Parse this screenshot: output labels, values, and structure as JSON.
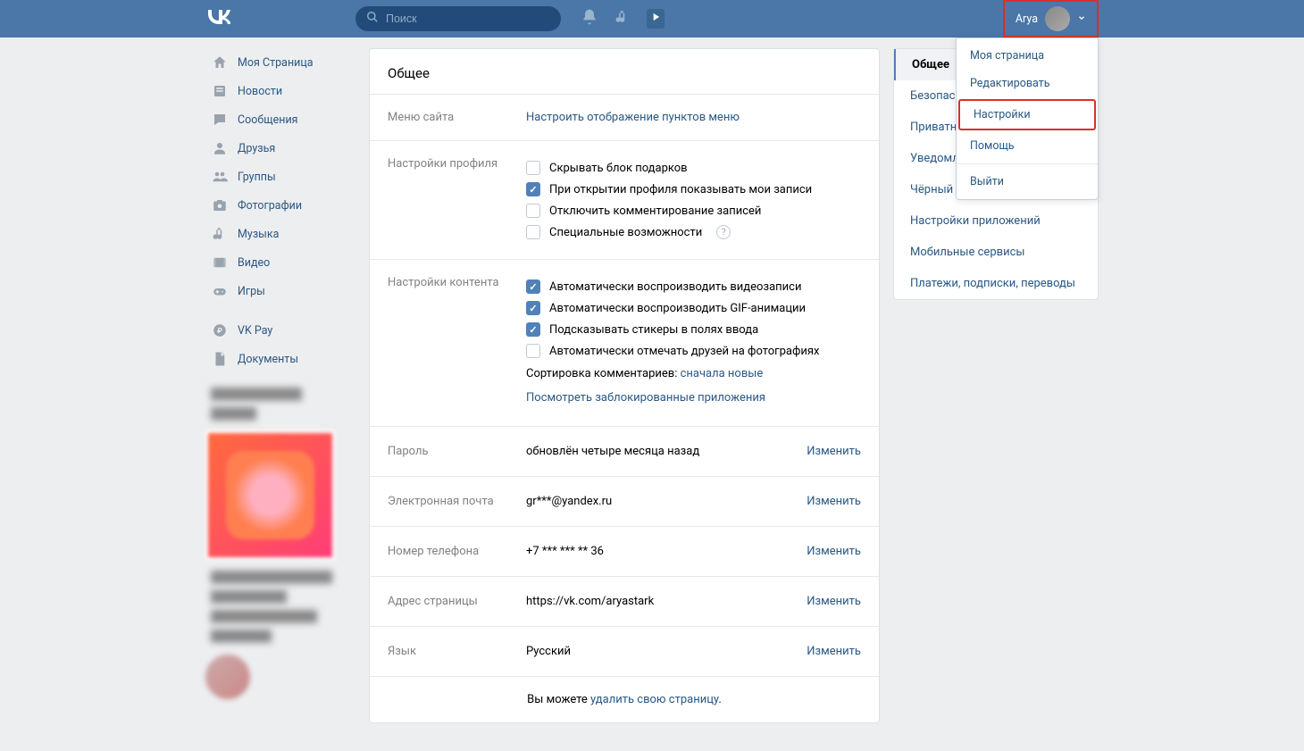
{
  "header": {
    "search_placeholder": "Поиск",
    "user_name": "Arya"
  },
  "dropdown": {
    "items": [
      "Моя страница",
      "Редактировать",
      "Настройки",
      "Помощь",
      "Выйти"
    ],
    "highlight_index": 2
  },
  "left_nav": {
    "items": [
      {
        "icon": "home",
        "label": "Моя Страница"
      },
      {
        "icon": "news",
        "label": "Новости"
      },
      {
        "icon": "msg",
        "label": "Сообщения"
      },
      {
        "icon": "friends",
        "label": "Друзья"
      },
      {
        "icon": "groups",
        "label": "Группы"
      },
      {
        "icon": "photos",
        "label": "Фотографии"
      },
      {
        "icon": "music",
        "label": "Музыка"
      },
      {
        "icon": "video",
        "label": "Видео"
      },
      {
        "icon": "games",
        "label": "Игры"
      }
    ],
    "extra": [
      {
        "icon": "pay",
        "label": "VK Pay"
      },
      {
        "icon": "docs",
        "label": "Документы"
      }
    ]
  },
  "page_title": "Общее",
  "sections": {
    "menu": {
      "label": "Меню сайта",
      "link": "Настроить отображение пунктов меню"
    },
    "profile": {
      "label": "Настройки профиля",
      "checks": [
        {
          "checked": false,
          "text": "Скрывать блок подарков"
        },
        {
          "checked": true,
          "text": "При открытии профиля показывать мои записи"
        },
        {
          "checked": false,
          "text": "Отключить комментирование записей"
        },
        {
          "checked": false,
          "text": "Специальные возможности",
          "help": true
        }
      ]
    },
    "content": {
      "label": "Настройки контента",
      "checks": [
        {
          "checked": true,
          "text": "Автоматически воспроизводить видеозаписи"
        },
        {
          "checked": true,
          "text": "Автоматически воспроизводить GIF-анимации"
        },
        {
          "checked": true,
          "text": "Подсказывать стикеры в полях ввода"
        },
        {
          "checked": false,
          "text": "Автоматически отмечать друзей на фотографиях"
        }
      ],
      "sort_label": "Сортировка комментариев: ",
      "sort_value": "сначала новые",
      "blocked_link": "Посмотреть заблокированные приложения"
    }
  },
  "lines": [
    {
      "key": "password",
      "label": "Пароль",
      "value": "обновлён четыре месяца назад",
      "action": "Изменить"
    },
    {
      "key": "email",
      "label": "Электронная почта",
      "value": "gr***@yandex.ru",
      "action": "Изменить"
    },
    {
      "key": "phone",
      "label": "Номер телефона",
      "value": "+7 *** *** ** 36",
      "action": "Изменить"
    },
    {
      "key": "url",
      "label": "Адрес страницы",
      "value": "https://vk.com/aryastark",
      "action": "Изменить"
    },
    {
      "key": "lang",
      "label": "Язык",
      "value": "Русский",
      "action": "Изменить"
    }
  ],
  "footer": {
    "prefix": "Вы можете ",
    "link": "удалить свою страницу",
    "suffix": "."
  },
  "right_nav": {
    "items": [
      "Общее",
      "Безопасность",
      "Приватность",
      "Уведомления",
      "Чёрный список",
      "Настройки приложений",
      "Мобильные сервисы",
      "Платежи, подписки, переводы"
    ],
    "active_index": 0
  }
}
